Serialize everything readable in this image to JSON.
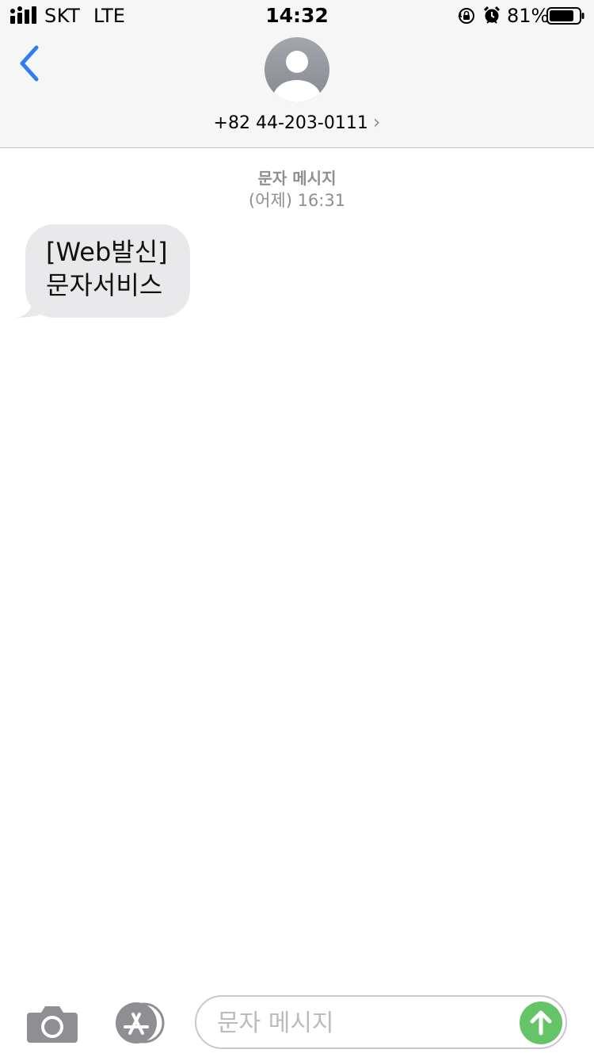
{
  "status_bar": {
    "carrier": "SKT",
    "network": "LTE",
    "time": "14:32",
    "battery_percent": "81%",
    "icons": [
      "signal-icon",
      "rotation-lock-icon",
      "alarm-icon",
      "battery-icon"
    ]
  },
  "header": {
    "contact": "+82 44-203-0111",
    "chevron": "›",
    "icons": [
      "back-chevron-icon",
      "avatar-person-icon"
    ]
  },
  "conversation": {
    "type_label": "문자 메시지",
    "timestamp": "(어제) 16:31",
    "messages": [
      {
        "direction": "incoming",
        "text": "[Web발신]\n문자서비스"
      }
    ]
  },
  "input_bar": {
    "placeholder": "문자 메시지",
    "icons": [
      "camera-icon",
      "app-store-icon",
      "send-arrow-icon"
    ]
  },
  "colors": {
    "accent_blue": "#2f7cf6",
    "send_green": "#65c466",
    "bubble_gray": "#e9e9eb",
    "header_bg": "#f6f6f6",
    "meta_gray": "#8e8e93"
  }
}
